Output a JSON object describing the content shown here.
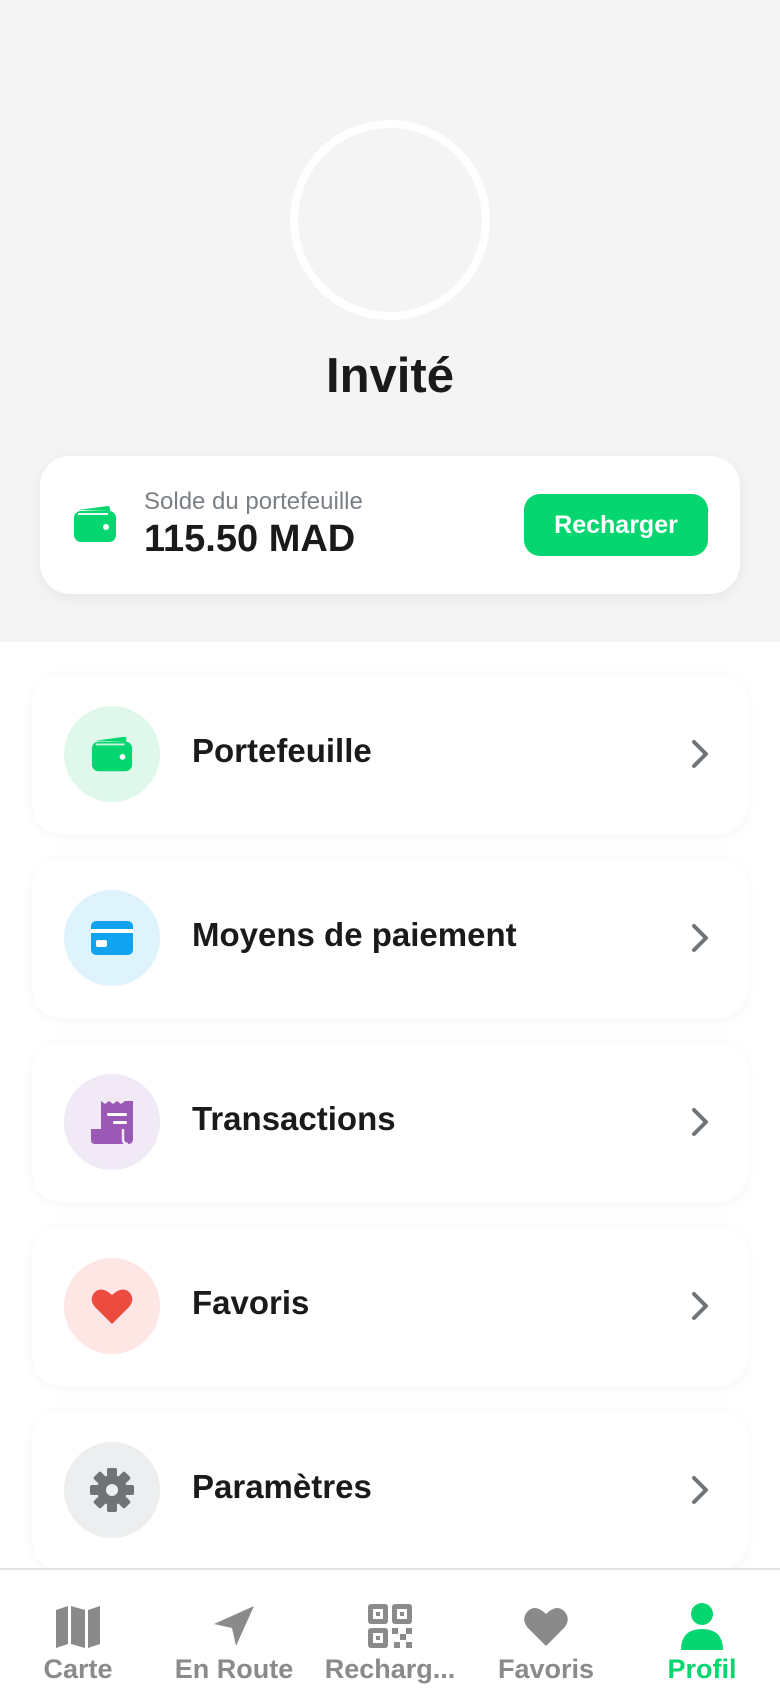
{
  "profile": {
    "name": "Invité"
  },
  "wallet": {
    "label": "Solde du portefeuille",
    "amount": "115.50 MAD",
    "recharge_label": "Recharger",
    "icon": "wallet-icon"
  },
  "menu": {
    "items": [
      {
        "label": "Portefeuille",
        "icon": "wallet-icon",
        "color": "#06d66f",
        "bg": "#dff8eb"
      },
      {
        "label": "Moyens de paiement",
        "icon": "credit-card-icon",
        "color": "#12a3f0",
        "bg": "#dff3fd"
      },
      {
        "label": "Transactions",
        "icon": "receipt-icon",
        "color": "#9b59b6",
        "bg": "#f2e9f7"
      },
      {
        "label": "Favoris",
        "icon": "heart-icon",
        "color": "#ec4c3f",
        "bg": "#fde6e4"
      },
      {
        "label": "Paramètres",
        "icon": "gear-icon",
        "color": "#6e7476",
        "bg": "#eceeef"
      }
    ]
  },
  "nav": {
    "items": [
      {
        "label": "Carte",
        "icon": "map-icon",
        "active": false
      },
      {
        "label": "En Route",
        "icon": "navigation-arrow-icon",
        "active": false
      },
      {
        "label": "Recharg...",
        "icon": "qr-code-icon",
        "active": false
      },
      {
        "label": "Favoris",
        "icon": "heart-icon",
        "active": false
      },
      {
        "label": "Profil",
        "icon": "person-icon",
        "active": true
      }
    ]
  },
  "colors": {
    "accent": "#06d66f",
    "nav_inactive": "#8a8a8a",
    "header_bg": "#f4f4f4"
  }
}
